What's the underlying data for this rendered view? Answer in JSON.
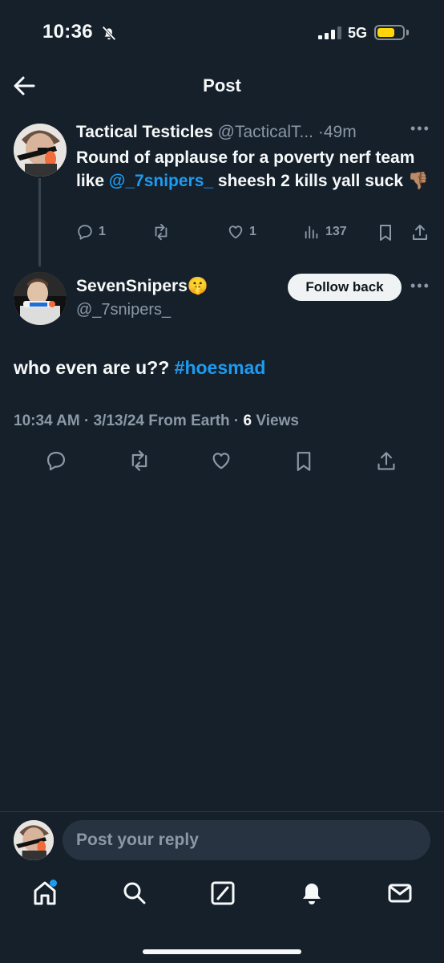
{
  "status_bar": {
    "time": "10:36",
    "network": "5G"
  },
  "header": {
    "title": "Post"
  },
  "original_post": {
    "name": "Tactical Testicles",
    "handle": "@TacticalT...",
    "separator": "·",
    "age": "49m",
    "text_part1": "Round of applause for a poverty nerf team like ",
    "mention": "@_7snipers_",
    "text_part2": " sheesh 2 kills yall suck ",
    "emoji": "👎🏽",
    "replies": "1",
    "likes": "1",
    "views": "137"
  },
  "reply_post": {
    "name": "SevenSnipers",
    "name_emoji": "🤫",
    "handle": "@_7snipers_",
    "follow_label": "Follow back",
    "text": "who even are u?? ",
    "hashtag": "#hoesmad",
    "meta_time": "10:34 AM",
    "meta_sep1": " · ",
    "meta_date": "3/13/24",
    "meta_source": " From Earth",
    "meta_sep2": " · ",
    "meta_views_count": "6",
    "meta_views_label": " Views"
  },
  "composer": {
    "placeholder": "Post your reply"
  },
  "colors": {
    "background": "#15202b",
    "accent": "#1d9bf0",
    "muted": "#8b98a5"
  }
}
